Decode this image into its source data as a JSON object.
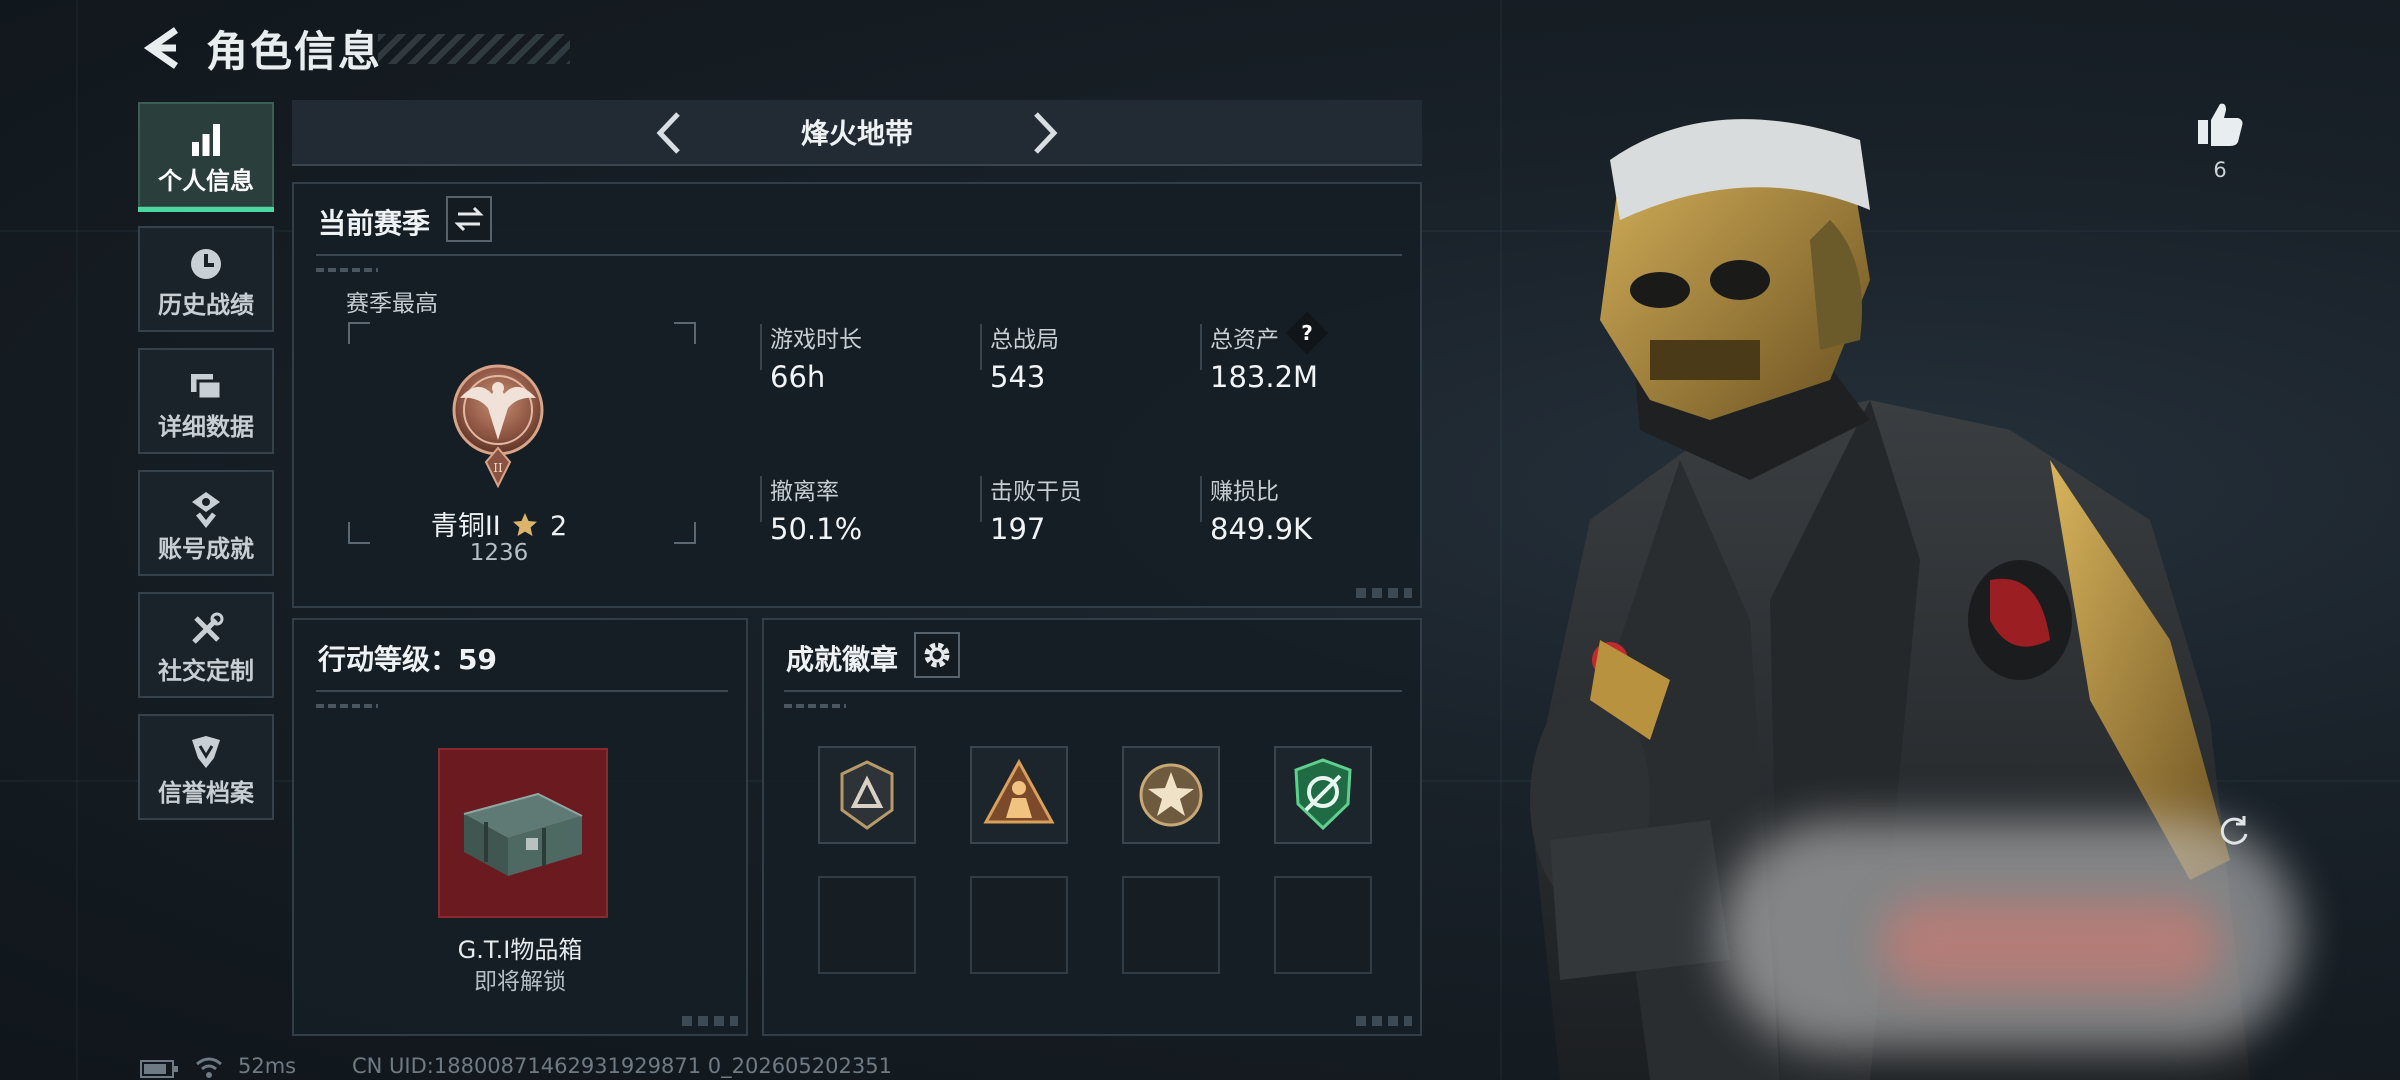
{
  "header": {
    "title": "角色信息",
    "back_icon": "back-arrow-icon"
  },
  "sidebar": {
    "items": [
      {
        "label": "个人信息",
        "icon": "bar-chart-icon",
        "active": true
      },
      {
        "label": "历史战绩",
        "icon": "clock-icon",
        "active": false
      },
      {
        "label": "详细数据",
        "icon": "cards-icon",
        "active": false
      },
      {
        "label": "账号成就",
        "icon": "medal-icon",
        "active": false
      },
      {
        "label": "社交定制",
        "icon": "tools-icon",
        "active": false
      },
      {
        "label": "信誉档案",
        "icon": "shield-icon",
        "active": false
      }
    ]
  },
  "mode_selector": {
    "label": "烽火地带"
  },
  "season": {
    "title": "当前赛季",
    "peak_label": "赛季最高",
    "rank_name": "青铜II",
    "rank_stars": "2",
    "rank_score": "1236",
    "stats": [
      {
        "label": "游戏时长",
        "value": "66h"
      },
      {
        "label": "总战局",
        "value": "543"
      },
      {
        "label": "总资产",
        "value": "183.2M",
        "help": "?"
      },
      {
        "label": "撤离率",
        "value": "50.1%"
      },
      {
        "label": "击败干员",
        "value": "197"
      },
      {
        "label": "赚损比",
        "value": "849.9K"
      }
    ]
  },
  "action_level": {
    "title": "行动等级：59",
    "reward_name": "G.T.I物品箱",
    "reward_status": "即将解锁"
  },
  "badges": {
    "title": "成就徽章",
    "slots": [
      {
        "icon": "triangle-badge-icon",
        "filled": true
      },
      {
        "icon": "soldier-badge-icon",
        "filled": true
      },
      {
        "icon": "star-badge-icon",
        "filled": true
      },
      {
        "icon": "green-shield-badge-icon",
        "filled": true
      },
      {
        "icon": "",
        "filled": false
      },
      {
        "icon": "",
        "filled": false
      },
      {
        "icon": "",
        "filled": false
      },
      {
        "icon": "",
        "filled": false
      }
    ]
  },
  "likes": {
    "count": "6"
  },
  "footer": {
    "ping": "52ms",
    "uid": "CN UID:18800871462931929871 0_202605202351"
  },
  "colors": {
    "accent": "#4dd7a0",
    "panel": "#161e25",
    "border": "#313d47",
    "reward_bg": "#6b1b1f"
  }
}
